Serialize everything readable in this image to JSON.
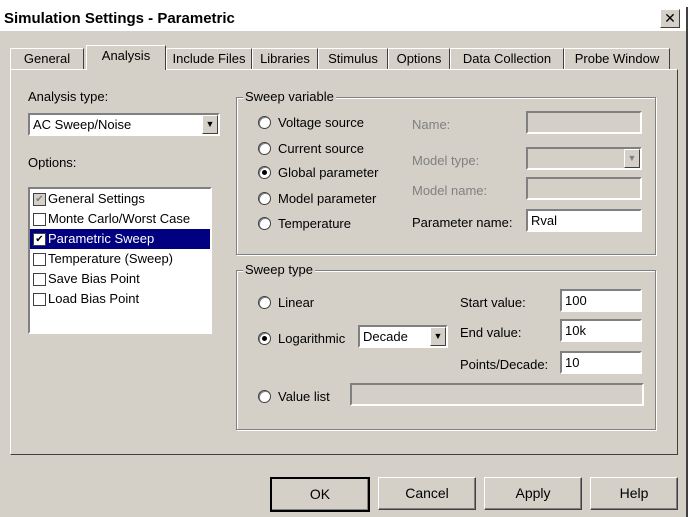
{
  "window": {
    "title": "Simulation Settings - Parametric",
    "close_glyph": "✕"
  },
  "tabs": [
    "General",
    "Analysis",
    "Include Files",
    "Libraries",
    "Stimulus",
    "Options",
    "Data Collection",
    "Probe Window"
  ],
  "analysis": {
    "type_label": "Analysis type:",
    "type_value": "AC Sweep/Noise",
    "options_label": "Options:",
    "options": [
      {
        "label": "General Settings",
        "checked": true,
        "dim": true
      },
      {
        "label": "Monte Carlo/Worst Case",
        "checked": false
      },
      {
        "label": "Parametric Sweep",
        "checked": true,
        "selected": true
      },
      {
        "label": "Temperature (Sweep)",
        "checked": false
      },
      {
        "label": "Save Bias Point",
        "checked": false
      },
      {
        "label": "Load Bias Point",
        "checked": false
      }
    ]
  },
  "sweep_variable": {
    "group_title": "Sweep variable",
    "radios": [
      {
        "label": "Voltage source",
        "selected": false
      },
      {
        "label": "Current source",
        "selected": false
      },
      {
        "label": "Global parameter",
        "selected": true
      },
      {
        "label": "Model parameter",
        "selected": false
      },
      {
        "label": "Temperature",
        "selected": false
      }
    ],
    "name_label": "Name:",
    "model_type_label": "Model type:",
    "model_name_label": "Model name:",
    "parameter_name_label": "Parameter name:",
    "parameter_name_value": "Rval"
  },
  "sweep_type": {
    "group_title": "Sweep type",
    "linear_label": "Linear",
    "log_label": "Logarithmic",
    "log_selected": true,
    "log_scale_value": "Decade",
    "value_list_label": "Value list",
    "start_label": "Start value:",
    "start_value": "100",
    "end_label": "End value:",
    "end_value": "10k",
    "points_label": "Points/Decade:",
    "points_value": "10"
  },
  "buttons": {
    "ok": "OK",
    "cancel": "Cancel",
    "apply": "Apply",
    "help": "Help"
  },
  "icons": {
    "dropdown": "chevron-down-icon",
    "check": "check-icon",
    "close": "close-icon"
  }
}
